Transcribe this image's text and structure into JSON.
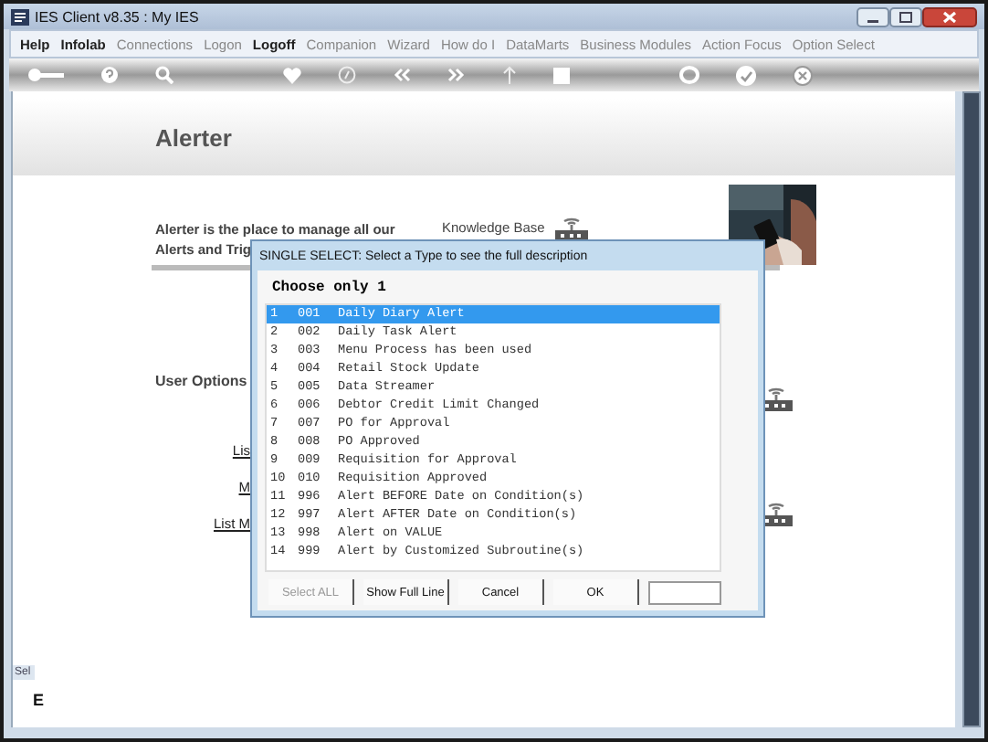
{
  "window": {
    "title": "IES Client v8.35 : My IES"
  },
  "menu": [
    {
      "label": "Help",
      "disabled": false
    },
    {
      "label": "Infolab",
      "disabled": false
    },
    {
      "label": "Connections",
      "disabled": true
    },
    {
      "label": "Logon",
      "disabled": true
    },
    {
      "label": "Logoff",
      "disabled": false
    },
    {
      "label": "Companion",
      "disabled": true
    },
    {
      "label": "Wizard",
      "disabled": true
    },
    {
      "label": "How do I",
      "disabled": true
    },
    {
      "label": "DataMarts",
      "disabled": true
    },
    {
      "label": "Business Modules",
      "disabled": true
    },
    {
      "label": "Action Focus",
      "disabled": true
    },
    {
      "label": "Option Select",
      "disabled": true
    }
  ],
  "page": {
    "title": "Alerter",
    "intro_lines": [
      "Alerter is the place to manage all our",
      "Alerts and Trig"
    ],
    "knowledge_base": "Knowledge Base",
    "section": "User Options",
    "links": [
      "Lis",
      "M",
      "List M"
    ],
    "side_tab": "Sel",
    "side_letter": "E"
  },
  "dialog": {
    "title": "SINGLE SELECT: Select a Type to see the full description",
    "heading": "Choose only 1",
    "rows": [
      {
        "no": "1",
        "code": "001",
        "name": "Daily Diary Alert",
        "selected": true
      },
      {
        "no": "2",
        "code": "002",
        "name": "Daily Task Alert",
        "selected": false
      },
      {
        "no": "3",
        "code": "003",
        "name": "Menu Process has been used",
        "selected": false
      },
      {
        "no": "4",
        "code": "004",
        "name": "Retail Stock Update",
        "selected": false
      },
      {
        "no": "5",
        "code": "005",
        "name": "Data Streamer",
        "selected": false
      },
      {
        "no": "6",
        "code": "006",
        "name": "Debtor Credit Limit Changed",
        "selected": false
      },
      {
        "no": "7",
        "code": "007",
        "name": "PO for Approval",
        "selected": false
      },
      {
        "no": "8",
        "code": "008",
        "name": "PO Approved",
        "selected": false
      },
      {
        "no": "9",
        "code": "009",
        "name": "Requisition for Approval",
        "selected": false
      },
      {
        "no": "10",
        "code": "010",
        "name": "Requisition Approved",
        "selected": false
      },
      {
        "no": "11",
        "code": "996",
        "name": "Alert BEFORE Date on Condition(s)",
        "selected": false
      },
      {
        "no": "12",
        "code": "997",
        "name": "Alert AFTER Date on Condition(s)",
        "selected": false
      },
      {
        "no": "13",
        "code": "998",
        "name": "Alert on VALUE",
        "selected": false
      },
      {
        "no": "14",
        "code": "999",
        "name": "Alert by Customized Subroutine(s)",
        "selected": false
      }
    ],
    "buttons": [
      {
        "label": "Select ALL",
        "disabled": true
      },
      {
        "label": "Show Full Line",
        "disabled": false
      },
      {
        "label": "Cancel",
        "disabled": false
      },
      {
        "label": "OK",
        "disabled": false
      }
    ]
  }
}
